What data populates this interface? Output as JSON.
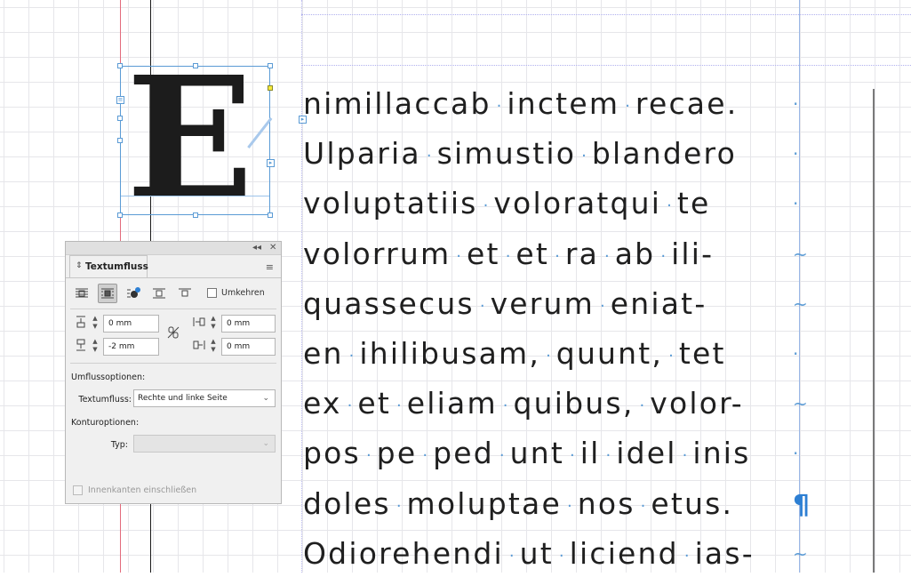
{
  "body_text": {
    "lines": [
      {
        "words": [
          "nimillaccab",
          "inctem",
          "recae."
        ],
        "end": "·"
      },
      {
        "words": [
          "Ulparia",
          "simustio",
          "blandero"
        ],
        "end": "·"
      },
      {
        "words": [
          "voluptatiis",
          "voloratqui",
          "te"
        ],
        "end": "·"
      },
      {
        "words": [
          "volorrum",
          "et",
          "et",
          "ra",
          "ab",
          "ili-"
        ],
        "end": "~"
      },
      {
        "words": [
          "quassecus",
          "verum",
          "eniat-"
        ],
        "end": "~"
      },
      {
        "words": [
          "en",
          "ihilibusam,",
          "quunt,",
          "tet"
        ],
        "end": "·"
      },
      {
        "words": [
          "ex",
          "et",
          "eliam",
          "quibus,",
          "volor-"
        ],
        "end": "~"
      },
      {
        "words": [
          "pos",
          "pe",
          "ped",
          "unt",
          "il",
          "idel",
          "inis"
        ],
        "end": "·"
      },
      {
        "words": [
          "doles",
          "moluptae",
          "nos",
          "etus."
        ],
        "end": "¶"
      },
      {
        "words": [
          "Odiorehendi",
          "ut",
          "liciend",
          "ias-"
        ],
        "end": "~"
      }
    ]
  },
  "dropcap": {
    "letter": "E"
  },
  "panel": {
    "title": "Textumfluss",
    "collapse_glyph": "◂◂",
    "close_glyph": "✕",
    "menu_glyph": "≡",
    "wrap_buttons": [
      {
        "name": "wrap-none-icon",
        "active": false
      },
      {
        "name": "wrap-bounding-box-icon",
        "active": true
      },
      {
        "name": "wrap-object-shape-icon",
        "active": false
      },
      {
        "name": "wrap-jump-object-icon",
        "active": false
      },
      {
        "name": "wrap-next-column-icon",
        "active": false
      }
    ],
    "invert_label": "Umkehren",
    "offset_top": "0 mm",
    "offset_bottom": "-2 mm",
    "offset_left": "0 mm",
    "offset_right": "0 mm",
    "wrap_options_label": "Umflussoptionen:",
    "wrap_to_label": "Textumfluss:",
    "wrap_to_value": "Rechte und linke Seite",
    "contour_options_label": "Konturoptionen:",
    "type_label": "Typ:",
    "type_value": "",
    "inside_edges_label": "Innenkanten einschließen"
  }
}
